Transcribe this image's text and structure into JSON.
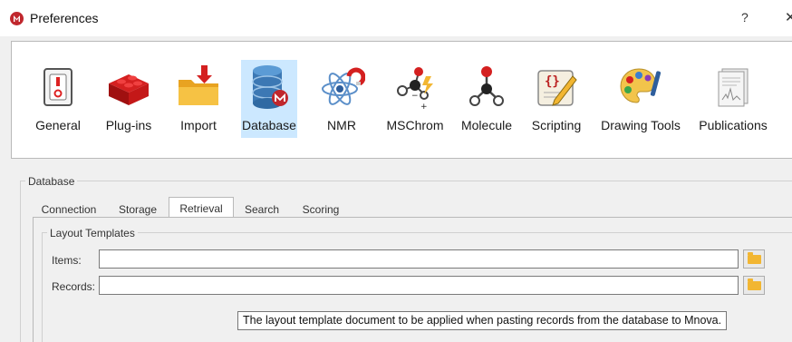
{
  "window": {
    "title": "Preferences",
    "help": "?",
    "close": "X"
  },
  "categories": [
    {
      "label": "General",
      "icon": "general-switch-icon"
    },
    {
      "label": "Plug-ins",
      "icon": "plugin-bricks-icon"
    },
    {
      "label": "Import",
      "icon": "import-folder-icon"
    },
    {
      "label": "Database",
      "icon": "database-icon",
      "selected": true
    },
    {
      "label": "NMR",
      "icon": "nmr-atom-icon"
    },
    {
      "label": "MSChrom",
      "icon": "mschrom-molecule-icon"
    },
    {
      "label": "Molecule",
      "icon": "molecule-icon"
    },
    {
      "label": "Scripting",
      "icon": "scripting-scroll-icon"
    },
    {
      "label": "Drawing Tools",
      "icon": "palette-icon"
    },
    {
      "label": "Publications",
      "icon": "publications-icon"
    }
  ],
  "database": {
    "group_title": "Database",
    "tabs": [
      {
        "label": "Connection"
      },
      {
        "label": "Storage"
      },
      {
        "label": "Retrieval",
        "active": true
      },
      {
        "label": "Search"
      },
      {
        "label": "Scoring"
      }
    ],
    "layout_templates": {
      "title": "Layout Templates",
      "items_label": "Items:",
      "items_value": "",
      "records_label": "Records:",
      "records_value": ""
    },
    "tooltip": "The layout template document to be applied when pasting records from the database to Mnova."
  },
  "colors": {
    "selected_bg": "#cce8ff",
    "brand_red": "#c0272d",
    "folder_yellow": "#f2b632"
  }
}
